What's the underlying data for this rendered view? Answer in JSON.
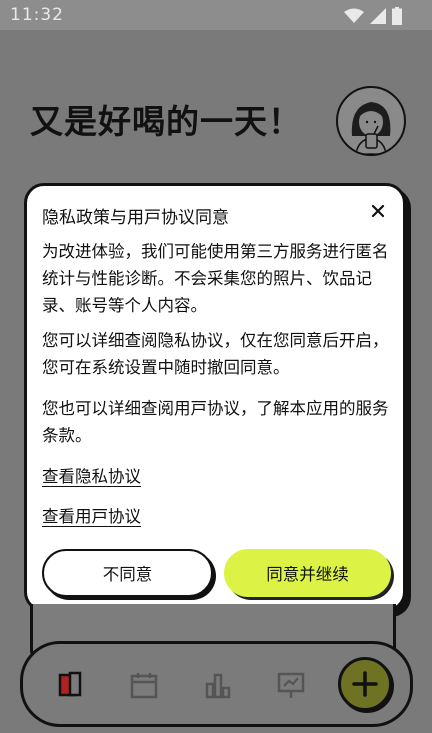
{
  "status_bar": {
    "time": "11:32"
  },
  "header": {
    "greeting": "又是好喝的一天！"
  },
  "dialog": {
    "title": "隐私政策与用戸协议同意",
    "paragraphs": [
      "为改进体验，我们可能使用第三方服务进行匿名统计与性能诊断。不会采集您的照片、饮品记录、账号等个人内容。",
      "您可以详细查阅隐私协议，仅在您同意后开启，您可在系统设置中随时撤回同意。",
      "您也可以详细查阅用戸协议，了解本应用的服务条款。"
    ],
    "link_privacy": "查看隐私协议",
    "link_terms": "查看用戸协议",
    "disagree_label": "不同意",
    "agree_label": "同意并继续"
  },
  "tab_bar": {
    "icons": [
      "drink-icon",
      "calendar-icon",
      "bar-chart-icon",
      "presentation-icon"
    ],
    "add_icon": "plus-icon"
  },
  "colors": {
    "accent": "#dcf346",
    "fab": "#6d7322"
  }
}
